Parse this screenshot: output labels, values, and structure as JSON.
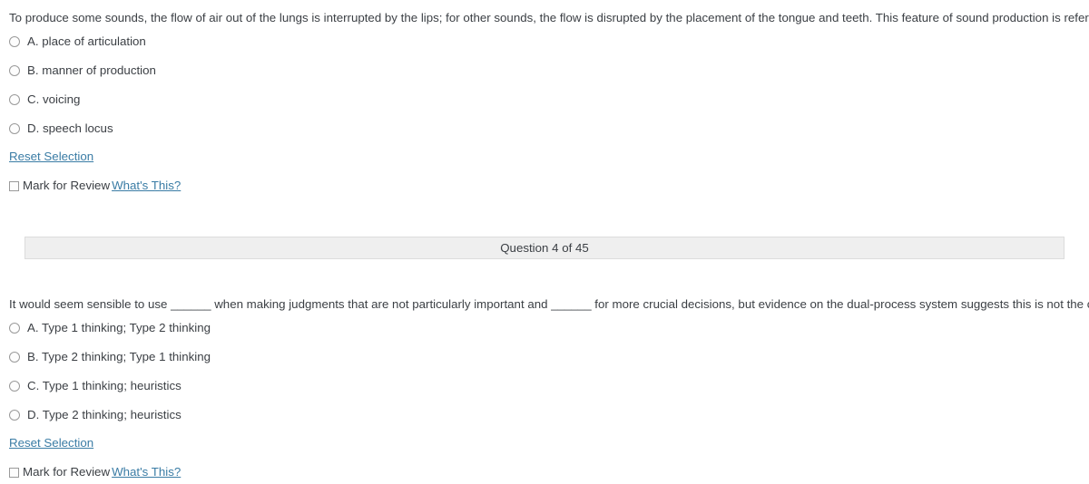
{
  "questions": [
    {
      "stem": "To produce some sounds, the flow of air out of the lungs is interrupted by the lips; for other sounds, the flow is disrupted by the placement of the tongue and teeth. This feature of sound production is referred to as:",
      "options": [
        {
          "label": "A. place of articulation"
        },
        {
          "label": "B. manner of production"
        },
        {
          "label": "C. voicing"
        },
        {
          "label": "D. speech locus"
        }
      ],
      "reset_label": "Reset Selection",
      "mark_for_review_label": "Mark for Review",
      "whats_this_label": "What's This?"
    },
    {
      "stem": "It would seem sensible to use ______ when making judgments that are not particularly important and ______ for more crucial decisions, but evidence on the dual-process system suggests this is not the case.",
      "options": [
        {
          "label": "A. Type 1 thinking; Type 2 thinking"
        },
        {
          "label": "B. Type 2 thinking; Type 1 thinking"
        },
        {
          "label": "C. Type 1 thinking; heuristics"
        },
        {
          "label": "D. Type 2 thinking; heuristics"
        }
      ],
      "reset_label": "Reset Selection",
      "mark_for_review_label": "Mark for Review",
      "whats_this_label": "What's This?"
    }
  ],
  "question_bar": {
    "text": "Question 4 of 45",
    "current": 4,
    "total": 45
  },
  "colors": {
    "link": "#3a7ca5",
    "text": "#3b3f44",
    "bar_background": "#efefef",
    "bar_border": "#dcdcdc",
    "control_border": "#9a9a9a"
  }
}
